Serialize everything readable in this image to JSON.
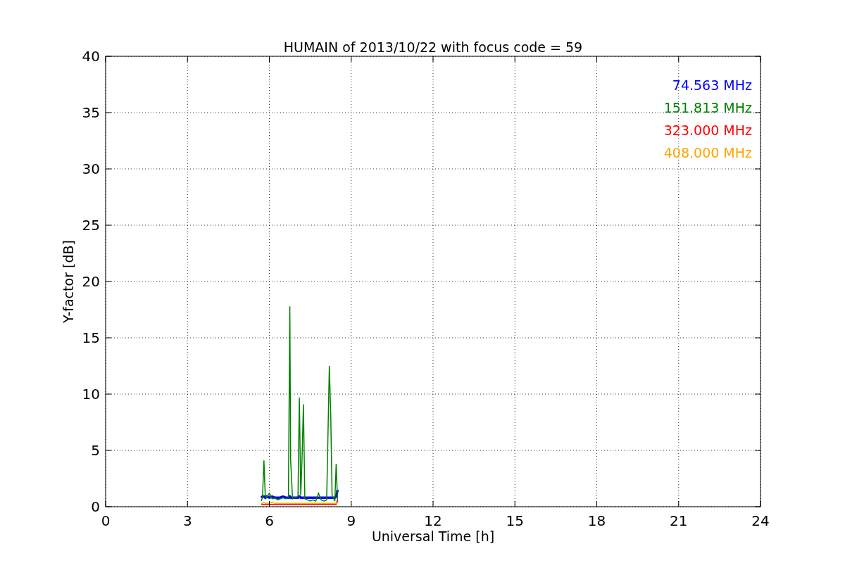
{
  "figure": {
    "chart_data": {
      "type": "line",
      "title": "HUMAIN of 2013/10/22 with focus code = 59",
      "xlabel": "Universal Time [h]",
      "ylabel": "Y-factor [dB]",
      "x": [
        5.7,
        5.75,
        5.8,
        5.85,
        5.9,
        6.0,
        6.1,
        6.2,
        6.3,
        6.4,
        6.5,
        6.6,
        6.7,
        6.75,
        6.78,
        6.85,
        6.95,
        7.05,
        7.1,
        7.15,
        7.2,
        7.25,
        7.3,
        7.4,
        7.5,
        7.6,
        7.7,
        7.8,
        7.9,
        8.0,
        8.1,
        8.15,
        8.2,
        8.25,
        8.3,
        8.4,
        8.45,
        8.5
      ],
      "series": [
        {
          "name": "74.563 MHz",
          "color": "#0000ff",
          "values": [
            0.8,
            0.9,
            0.9,
            0.8,
            0.9,
            0.8,
            0.9,
            0.8,
            0.8,
            0.8,
            0.9,
            0.8,
            0.8,
            0.9,
            0.8,
            0.8,
            0.8,
            0.8,
            0.9,
            0.8,
            0.8,
            0.8,
            0.8,
            0.8,
            0.8,
            0.8,
            0.8,
            0.8,
            0.8,
            0.8,
            0.8,
            0.8,
            0.8,
            0.8,
            0.8,
            0.8,
            0.9,
            1.5
          ]
        },
        {
          "name": "151.813 MHz",
          "color": "#008000",
          "values": [
            0.5,
            0.8,
            4.1,
            1.0,
            0.8,
            1.2,
            0.7,
            0.8,
            0.6,
            0.7,
            0.8,
            0.7,
            0.8,
            17.8,
            4.2,
            0.7,
            0.8,
            0.9,
            9.7,
            1.0,
            4.4,
            9.1,
            0.7,
            0.6,
            0.5,
            0.6,
            0.5,
            1.2,
            0.6,
            0.5,
            0.6,
            6.5,
            12.5,
            8.1,
            1.0,
            0.5,
            3.8,
            0.4
          ]
        },
        {
          "name": "323.000 MHz",
          "color": "#ff0000",
          "values": [
            0.2,
            0.2,
            0.2,
            0.2,
            0.2,
            0.2,
            0.2,
            0.2,
            0.2,
            0.2,
            0.2,
            0.2,
            0.2,
            0.2,
            0.2,
            0.2,
            0.2,
            0.2,
            0.2,
            0.2,
            0.2,
            0.2,
            0.2,
            0.2,
            0.2,
            0.2,
            0.2,
            0.2,
            0.2,
            0.2,
            0.2,
            0.2,
            0.2,
            0.2,
            0.2,
            0.2,
            0.2,
            0.6
          ]
        },
        {
          "name": "408.000 MHz",
          "color": "#ffa500",
          "values": [
            0.3,
            0.3,
            0.4,
            0.3,
            0.3,
            0.3,
            0.4,
            0.3,
            0.3,
            0.3,
            0.3,
            0.3,
            0.3,
            0.3,
            0.3,
            0.3,
            0.3,
            0.3,
            0.3,
            0.3,
            0.3,
            0.3,
            0.3,
            0.3,
            0.3,
            0.3,
            0.3,
            0.3,
            0.3,
            0.3,
            0.3,
            0.3,
            0.3,
            0.3,
            0.3,
            0.3,
            0.3,
            0.3
          ]
        }
      ],
      "grid": true,
      "xlim": [
        0,
        24
      ],
      "ylim": [
        0,
        40
      ],
      "xticks": [
        0,
        3,
        6,
        9,
        12,
        15,
        18,
        21,
        24
      ],
      "yticks": [
        0,
        5,
        10,
        15,
        20,
        25,
        30,
        35,
        40
      ]
    }
  }
}
